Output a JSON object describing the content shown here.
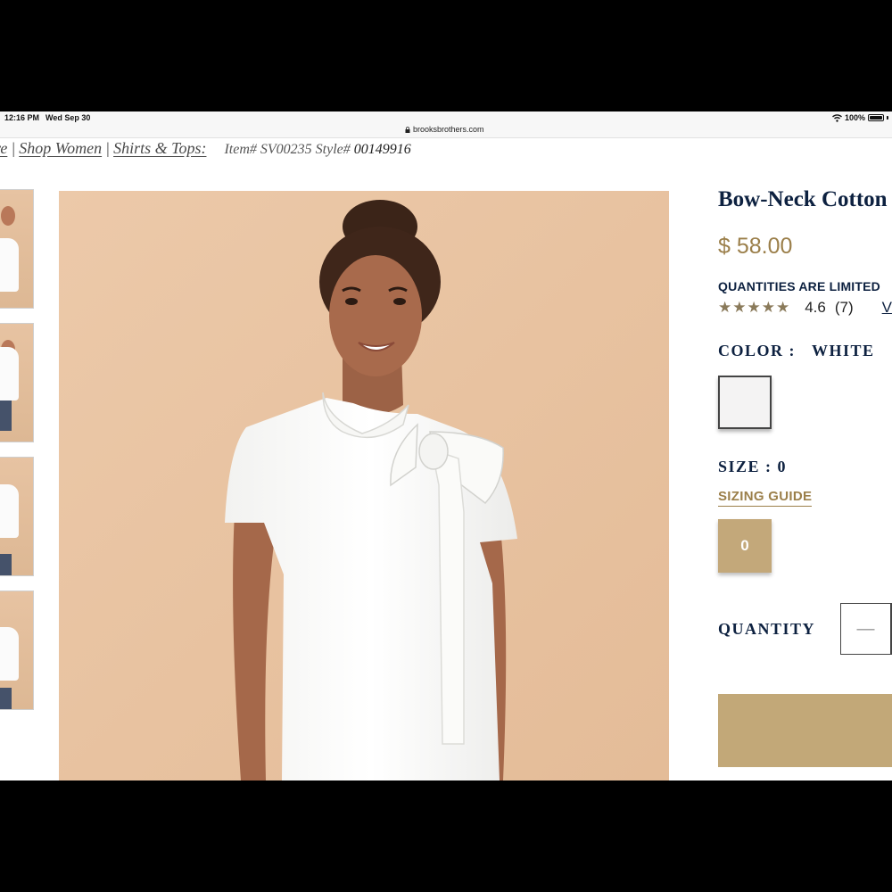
{
  "status_bar": {
    "time": "12:16 PM",
    "date": "Wed Sep 30",
    "url": "brooksbrothers.com",
    "battery": "100%"
  },
  "breadcrumb": {
    "items": [
      "re",
      "Shop Women",
      "Shirts & Tops:"
    ],
    "separator": "|",
    "item_prefix": "Item#",
    "item_no": "SV00235",
    "style_prefix": "Style#",
    "style_no": "00149916"
  },
  "product": {
    "title": "Bow-Neck Cotton",
    "price": "$ 58.00",
    "notice": "QUANTITIES ARE LIMITED",
    "stars": "★★★★★",
    "rating": "4.6",
    "review_count": "(7)",
    "view_link": "V",
    "color_label": "COLOR :",
    "color_value": "WHITE",
    "size_label": "SIZE : 0",
    "sizing_guide": "SIZING GUIDE",
    "size_option": "0",
    "quantity_label": "QUANTITY",
    "minus_symbol": "—"
  },
  "colors": {
    "navy": "#0d2140",
    "gold": "#9b7f4a",
    "button_gold": "#c2a878",
    "swatch_white": "#f4f3f3",
    "photo_background": "#e9c5a3"
  },
  "icons": [
    "lock-icon",
    "wifi-icon",
    "battery-icon",
    "star-icon"
  ]
}
